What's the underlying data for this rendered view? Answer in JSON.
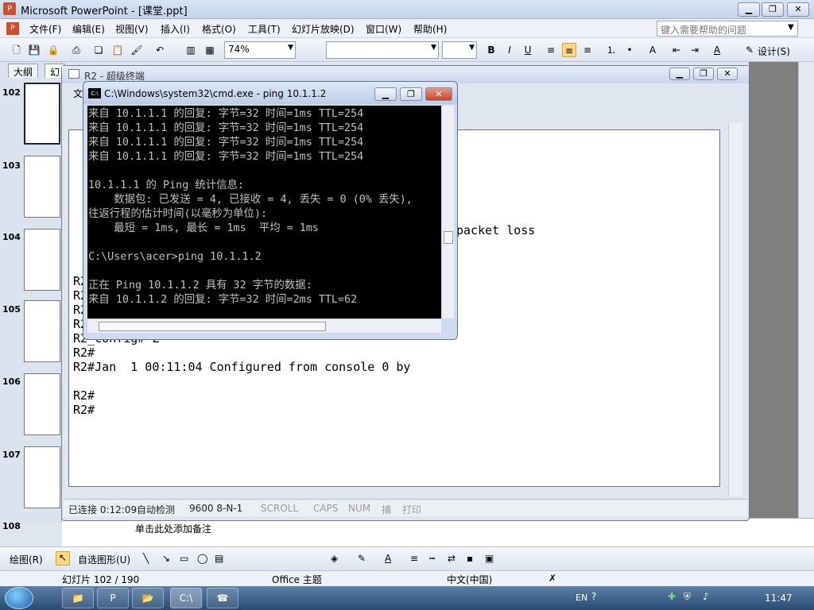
{
  "ppt": {
    "title": "Microsoft PowerPoint - [课堂.ppt]",
    "menus": [
      "文件(F)",
      "编辑(E)",
      "视图(V)",
      "插入(I)",
      "格式(O)",
      "工具(T)",
      "幻灯片放映(D)",
      "窗口(W)",
      "帮助(H)"
    ],
    "help_placeholder": "键入需要帮助的问题",
    "zoom": "74%",
    "design_label": "设计(S)",
    "tabs": [
      "大纲",
      "幻"
    ],
    "slide_numbers": [
      "102",
      "103",
      "104",
      "105",
      "106",
      "107",
      "108"
    ],
    "notes_placeholder": "单击此处添加备注",
    "status": {
      "slide": "幻灯片 102 / 190",
      "theme": "Office 主题",
      "language": "中文(中国)"
    },
    "drawing": {
      "draw_label": "绘图(R)",
      "autoshape_label": "自选图形(U)"
    },
    "background_text": "packet loss"
  },
  "hyperterminal": {
    "title": "R2 - 超级终端",
    "menu_char": "文",
    "lines": [
      "R2#",
      "R2#",
      "R2#config",
      "R2_config#ip route 10.1.1.0 255.255.255.0 172.16.1.1",
      "R2_config#^Z",
      "R2#",
      "R2#Jan  1 00:11:04 Configured from console 0 by",
      "",
      "R2#",
      "R2#"
    ],
    "status": {
      "connected": "已连接 0:12:09",
      "detect": "自动检测",
      "params": "9600 8-N-1",
      "scroll": "SCROLL",
      "caps": "CAPS",
      "num": "NUM",
      "capture": "捕",
      "print": "打印"
    }
  },
  "cmd": {
    "title": "C:\\Windows\\system32\\cmd.exe - ping  10.1.1.2",
    "lines": [
      "来自 10.1.1.1 的回复: 字节=32 时间=1ms TTL=254",
      "来自 10.1.1.1 的回复: 字节=32 时间=1ms TTL=254",
      "来自 10.1.1.1 的回复: 字节=32 时间=1ms TTL=254",
      "来自 10.1.1.1 的回复: 字节=32 时间=1ms TTL=254",
      "",
      "10.1.1.1 的 Ping 统计信息:",
      "    数据包: 已发送 = 4, 已接收 = 4, 丢失 = 0 (0% 丢失),",
      "往返行程的估计时间(以毫秒为单位):",
      "    最短 = 1ms, 最长 = 1ms  平均 = 1ms",
      "",
      "C:\\Users\\acer>ping 10.1.1.2",
      "",
      "正在 Ping 10.1.1.2 具有 32 字节的数据:",
      "来自 10.1.1.2 的回复: 字节=32 时间=2ms TTL=62"
    ]
  },
  "taskbar": {
    "clock": "11:47",
    "lang": "EN"
  },
  "colors": {
    "title_bg": "#c3d3ea",
    "taskbar": "#274b73",
    "cmd_bg": "#000000"
  }
}
